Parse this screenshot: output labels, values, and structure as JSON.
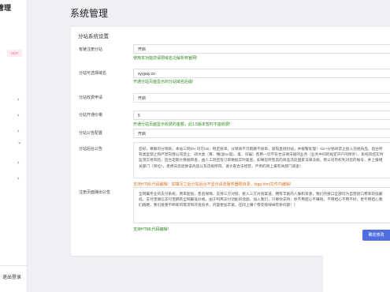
{
  "sidebar": {
    "brand": "管理",
    "hot_badge": "HOT",
    "logout": "退出登录",
    "chevron": "›",
    "chevron_down": "⌄"
  },
  "page_title": "系统管理",
  "section_title": "分站系统设置",
  "form": {
    "register_label": "有链注册分站",
    "register_value": "开启",
    "register_hint": "使用本功能前请把域名泛解析到官网!",
    "domain_label": "分站可选择域名",
    "domain_value": "xyypay.cn",
    "domain_hint": "开通分站页面显示的分站域名后缀!",
    "fee_label": "分站收费申请",
    "fee_value": "开启",
    "price_label": "分站开通价格",
    "price_value": "5",
    "price_hint": "开通分站页面显示收费的金额，此1.5版本暂时不能收费!",
    "notice_label": "分站公告配置",
    "notice_value": "开启",
    "announce_label": "分站后台公告",
    "announce_text": "您好，尊敬的分销商，本站三网3% 均可H5，稳定接单，分销商不可跑路不接单，发现直接封站，并报警处理！<br>分销商禁止接入违规商品、后台所有类型禁止和严禁向我公司禁止：四大类（黄、赌(含bc等)、毒、诈骗）售用一切不符合法律法规的业务（业务中间的规定开户的除外），系统风控实时监测交易风险，后台定期大数据筛查，由人工风控及订单数据实时复查，如果您所售卖的商品违反国家法律法规，我公司有权利对您的账号，并上报相关部门（单位），拒绝向您退换该商品以及违规所得。请大家合法经营，严肃的将上报有关部门调查！",
    "html_hint": "支持HTML代码编辑！如填写之后分站后台不显示请去服务器根目录，fzgg.html文件内编辑!",
    "popup_label": "注册页面弹出公告",
    "popup_text": "全网最专业的支付系统，费率超低，售后保障，支持三方对接，接入三方对接渠道，拥有丰富的人脉和资源，我们的接口全部均为自营接口费率较低最低，支付宝微信支付宝拥有全网最低价格，由于利用支付功能的话题，加入我们，只要你支持，你不用担心不赚钱，不用担心不用不好，更不用担心我们跑路，我们接受不断新的需求和开发技术，内容更加丰富，在同上赚个零花钱绰绰有余问题！）",
    "popup_hint": "支持HTML代码编辑!",
    "submit_label": "确定修改"
  },
  "colors": {
    "hint_green": "#2b8a1e",
    "hint_orange": "#e0701e",
    "primary": "#4f6fe0"
  }
}
